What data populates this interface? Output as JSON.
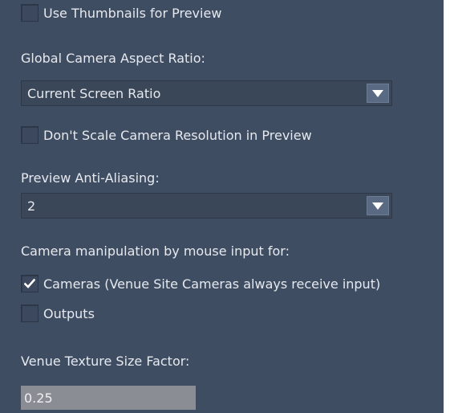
{
  "settings": {
    "use_thumbnails": {
      "label": "Use Thumbnails for Preview",
      "checked": false
    },
    "aspect_ratio": {
      "label": "Global Camera Aspect Ratio:",
      "value": "Current Screen Ratio"
    },
    "dont_scale": {
      "label": "Don't Scale Camera Resolution in Preview",
      "checked": false
    },
    "anti_aliasing": {
      "label": "Preview Anti-Aliasing:",
      "value": "2"
    },
    "manipulation": {
      "label": "Camera manipulation by mouse input for:",
      "cameras": {
        "label": "Cameras (Venue Site Cameras always receive input)",
        "checked": true
      },
      "outputs": {
        "label": "Outputs",
        "checked": false
      }
    },
    "texture": {
      "label": "Venue Texture Size Factor:",
      "value": "0.25"
    }
  },
  "icons": {
    "checkmark": "checkmark-icon",
    "dropdown": "triangle-down-icon"
  },
  "colors": {
    "panel_bg": "#3f4d63",
    "text": "#e6e9ee",
    "field_bg": "#8a8e94"
  }
}
